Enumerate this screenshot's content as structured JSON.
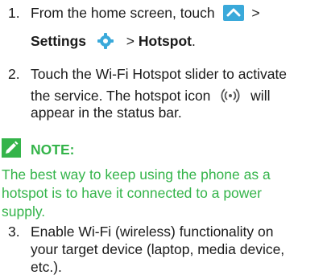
{
  "steps": [
    {
      "number": "1.",
      "line1": "From the home screen, touch",
      "line1_after": ">",
      "line2_settings": "Settings",
      "line2_after": "> ",
      "line2_hotspot": "Hotspot",
      "line2_period": "."
    },
    {
      "number": "2.",
      "line1": "Touch the Wi-Fi Hotspot slider to activate",
      "line2": "the service. The hotspot icon",
      "line2_after": "will",
      "line3": "appear in the status bar."
    },
    {
      "number": "3.",
      "line1": "Enable Wi-Fi (wireless) functionality on",
      "line2": "your target device (laptop, media device,",
      "line3": "etc.)."
    }
  ],
  "note": {
    "heading": "NOTE:",
    "line1": "The best way to keep using the phone as a",
    "line2": "hotspot is to have it connected to a power",
    "line3": "supply."
  },
  "colors": {
    "text": "#1a1a1a",
    "note_green": "#34b44a",
    "icon_blue": "#3aa9da"
  },
  "icons": [
    "chevron-up-icon",
    "settings-gear-icon",
    "hotspot-icon",
    "note-pencil-icon"
  ]
}
